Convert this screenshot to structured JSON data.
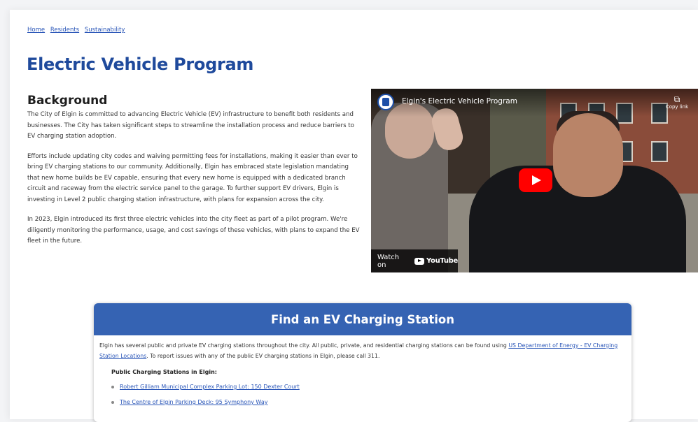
{
  "breadcrumb": [
    "Home",
    "Residents",
    "Sustainability"
  ],
  "page_title": "Electric Vehicle Program",
  "background": {
    "heading": "Background",
    "paragraphs": [
      "The City of Elgin is committed to advancing Electric Vehicle (EV) infrastructure to benefit both residents and businesses. The City has taken significant steps to streamline the installation process and reduce barriers to EV charging station adoption.",
      "Efforts include updating city codes and waiving permitting fees for installations, making it easier than ever to bring EV charging stations to our community. Additionally, Elgin has embraced state legislation mandating that new home builds be EV capable, ensuring that every new home is equipped with a dedicated branch circuit and raceway from the electric service panel to the garage. To further support EV drivers, Elgin is investing in Level 2 public charging station infrastructure, with plans for expansion across the city.",
      "In 2023, Elgin introduced its first three electric vehicles into the city fleet as part of a pilot program. We're diligently monitoring the performance, usage, and cost savings of these vehicles, with plans to expand the EV fleet in the future."
    ]
  },
  "video": {
    "title": "Elgin's Electric Vehicle Program",
    "copy_link_label": "Copy link",
    "watch_on_label": "Watch on",
    "platform_name": "YouTube"
  },
  "ev_card": {
    "heading": "Find an EV Charging Station",
    "text_before_link": "Elgin has several public and private EV charging stations throughout the city. All public, private, and residential charging stations can be found using ",
    "link_text": "US Department of Energy - EV Charging Station Locations",
    "text_after_link": ". To report issues with any of the public EV charging stations in Elgin, please call 311.",
    "stations_heading": "Public Charging Stations in Elgin:",
    "stations": [
      "Robert Gilliam Municipal Complex Parking Lot: 150 Dexter Court",
      "The Centre of Elgin Parking Deck: 95 Symphony Way"
    ]
  },
  "colors": {
    "title_blue": "#1f4a9c",
    "header_blue": "#3563b3",
    "link_blue": "#2a56b8",
    "youtube_red": "#ff0000"
  }
}
